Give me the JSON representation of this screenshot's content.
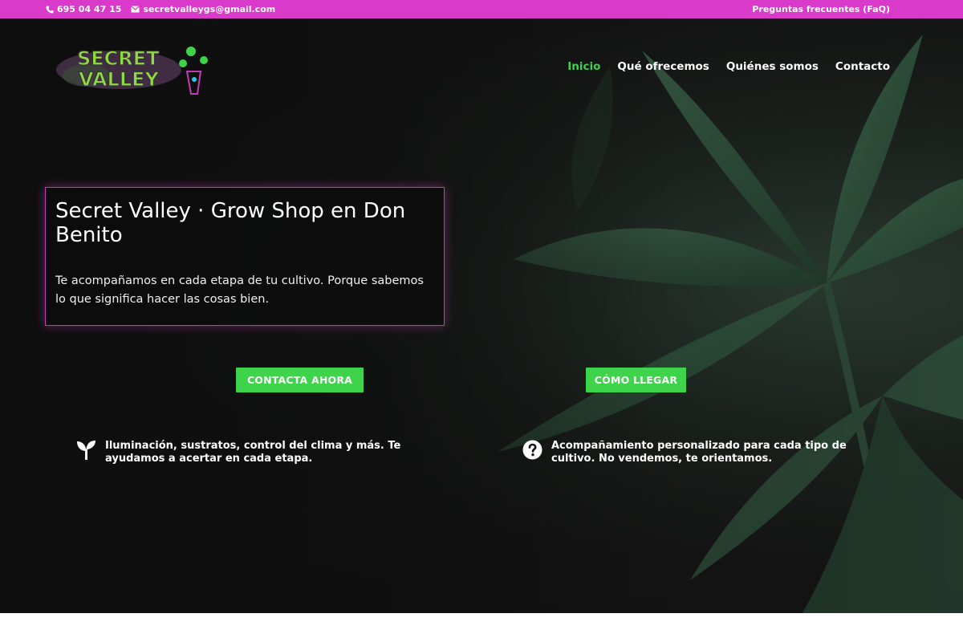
{
  "topbar": {
    "phone": "695 04 47 15",
    "email": "secretvalleygs@gmail.com",
    "faq_link": "Preguntas frecuentes (FaQ)"
  },
  "logo": {
    "line1": "SECRET",
    "line2": "VALLEY"
  },
  "nav": {
    "items": [
      {
        "label": "Inicio",
        "active": true
      },
      {
        "label": "Qué ofrecemos",
        "active": false
      },
      {
        "label": "Quiénes somos",
        "active": false
      },
      {
        "label": "Contacto",
        "active": false
      }
    ]
  },
  "hero": {
    "title": "Secret Valley · Grow Shop en Don Benito",
    "subtitle": "Te acompañamos en cada etapa de tu cultivo. Porque sabemos lo que significa hacer las cosas bien.",
    "cta_contact": "CONTACTA AHORA",
    "cta_route": "CÓMO LLEGAR"
  },
  "features": [
    {
      "icon": "sprout-icon",
      "text": "Iluminación, sustratos, control del clima y más. Te ayudamos a acertar en cada etapa."
    },
    {
      "icon": "question-circle-icon",
      "text": "Acompañamiento personalizado para cada tipo de cultivo. No vendemos, te orientamos."
    }
  ],
  "colors": {
    "topbar": "#d93ac9",
    "accent_green": "#3fd24b",
    "card_border": "#c23cb6",
    "hero_bg": "#141414"
  }
}
